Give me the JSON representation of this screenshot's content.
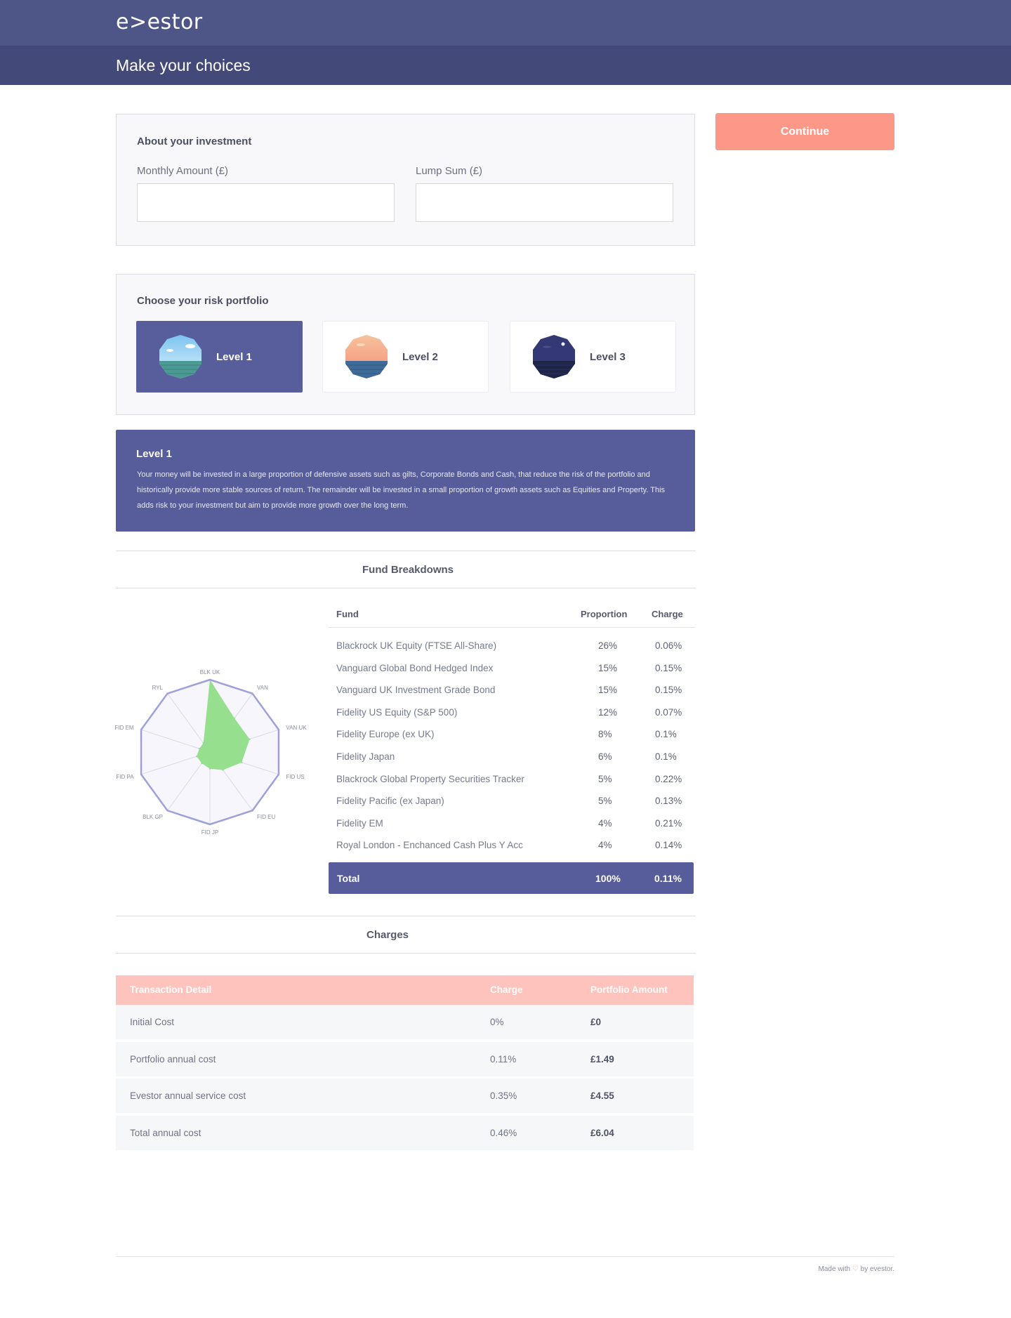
{
  "header": {
    "logo": "e>estor",
    "page_title": "Make your choices"
  },
  "actions": {
    "continue_label": "Continue"
  },
  "investment": {
    "heading": "About your investment",
    "monthly_label": "Monthly Amount (£)",
    "monthly_value": "",
    "lump_label": "Lump Sum (£)",
    "lump_value": ""
  },
  "risk": {
    "heading": "Choose your risk portfolio",
    "levels": [
      {
        "label": "Level 1",
        "selected": true
      },
      {
        "label": "Level 2",
        "selected": false
      },
      {
        "label": "Level 3",
        "selected": false
      }
    ]
  },
  "description": {
    "title": "Level 1",
    "body": "Your money will be invested in a large proportion of defensive assets such as gilts, Corporate Bonds and Cash, that reduce the risk of the portfolio and historically provide more stable sources of return. The remainder will be invested in a small proportion of growth assets such as Equities and Property. This adds risk to your investment but aim to provide more growth over the long term."
  },
  "fund_breakdowns": {
    "title": "Fund Breakdowns",
    "columns": {
      "fund": "Fund",
      "proportion": "Proportion",
      "charge": "Charge"
    },
    "rows": [
      {
        "fund": "Blackrock UK Equity (FTSE All-Share)",
        "proportion": "26%",
        "charge": "0.06%"
      },
      {
        "fund": "Vanguard Global Bond Hedged Index",
        "proportion": "15%",
        "charge": "0.15%"
      },
      {
        "fund": "Vanguard UK Investment Grade Bond",
        "proportion": "15%",
        "charge": "0.15%"
      },
      {
        "fund": "Fidelity US Equity (S&P 500)",
        "proportion": "12%",
        "charge": "0.07%"
      },
      {
        "fund": "Fidelity Europe (ex UK)",
        "proportion": "8%",
        "charge": "0.1%"
      },
      {
        "fund": "Fidelity Japan",
        "proportion": "6%",
        "charge": "0.1%"
      },
      {
        "fund": "Blackrock Global Property Securities Tracker",
        "proportion": "5%",
        "charge": "0.22%"
      },
      {
        "fund": "Fidelity Pacific (ex Japan)",
        "proportion": "5%",
        "charge": "0.13%"
      },
      {
        "fund": "Fidelity EM",
        "proportion": "4%",
        "charge": "0.21%"
      },
      {
        "fund": "Royal London - Enchanced Cash Plus Y Acc",
        "proportion": "4%",
        "charge": "0.14%"
      }
    ],
    "total": {
      "label": "Total",
      "proportion": "100%",
      "charge": "0.11%"
    }
  },
  "chart_data": {
    "type": "radar",
    "axes": [
      "BLK UK",
      "VAN",
      "VAN UK",
      "FID US",
      "FID EU",
      "FID JP",
      "BLK GP",
      "FID PA",
      "FID EM",
      "RYL"
    ],
    "values": [
      26,
      15,
      15,
      12,
      8,
      6,
      5,
      5,
      4,
      4
    ],
    "rmax": 26,
    "fill_color": "#95df8e",
    "frame_color": "#9ea1d9"
  },
  "charges": {
    "title": "Charges",
    "columns": {
      "detail": "Transaction Detail",
      "charge": "Charge",
      "amount": "Portfolio Amount"
    },
    "rows": [
      {
        "detail": "Initial Cost",
        "charge": "0%",
        "amount": "£0"
      },
      {
        "detail": "Portfolio annual cost",
        "charge": "0.11%",
        "amount": "£1.49"
      },
      {
        "detail": "Evestor annual service cost",
        "charge": "0.35%",
        "amount": "£4.55"
      },
      {
        "detail": "Total annual cost",
        "charge": "0.46%",
        "amount": "£6.04"
      }
    ]
  },
  "footer": {
    "made_with": "Made with",
    "heart_icon": "heart-icon",
    "by": "by evestor."
  },
  "colors": {
    "brand": "#4e5688",
    "accent": "#fd9888",
    "selected": "#575c9b",
    "chart_fill": "#95df8e"
  }
}
